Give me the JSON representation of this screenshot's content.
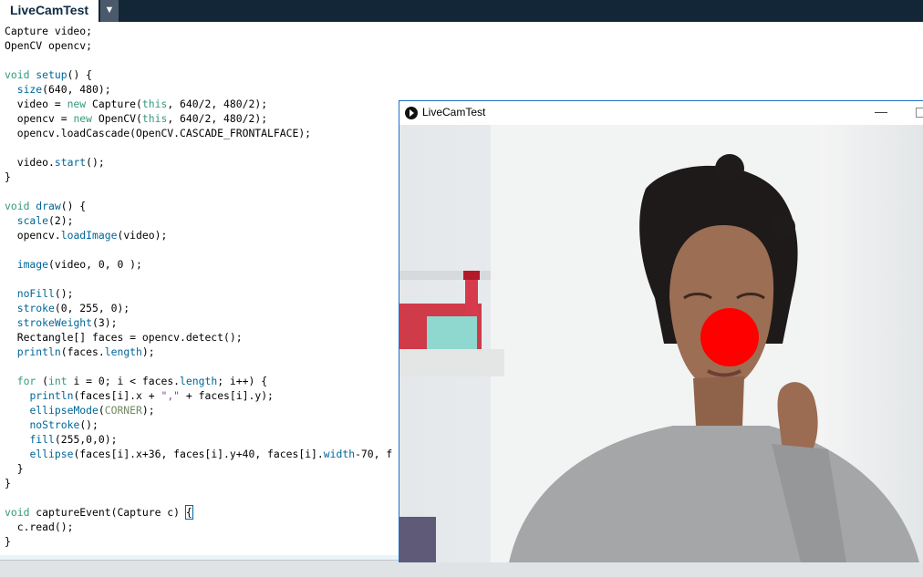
{
  "tab": {
    "label": "LiveCamTest",
    "menu_icon": "▼"
  },
  "code_lines": [
    "Capture video;",
    "OpenCV opencv;",
    "",
    "void setup() {",
    "  size(640, 480);",
    "  video = new Capture(this, 640/2, 480/2);",
    "  opencv = new OpenCV(this, 640/2, 480/2);",
    "  opencv.loadCascade(OpenCV.CASCADE_FRONTALFACE);",
    "",
    "  video.start();",
    "}",
    "",
    "void draw() {",
    "  scale(2);",
    "  opencv.loadImage(video);",
    "",
    "  image(video, 0, 0 );",
    "",
    "  noFill();",
    "  stroke(0, 255, 0);",
    "  strokeWeight(3);",
    "  Rectangle[] faces = opencv.detect();",
    "  println(faces.length);",
    "",
    "  for (int i = 0; i < faces.length; i++) {",
    "    println(faces[i].x + \",\" + faces[i].y);",
    "    ellipseMode(CORNER);",
    "    noStroke();",
    "    fill(255,0,0);",
    "    ellipse(faces[i].x+36, faces[i].y+40, faces[i].width-70, f",
    "  }",
    "}",
    "",
    "void captureEvent(Capture c) {",
    "  c.read();",
    "}"
  ],
  "sketch_window": {
    "title": "LiveCamTest",
    "minimize_icon": "—",
    "nose_color": "#ff0000"
  },
  "colors": {
    "keyword": "#33997e",
    "function": "#006699",
    "literal": "#e2661a",
    "string": "#7d4793",
    "tabbar": "#132638"
  }
}
